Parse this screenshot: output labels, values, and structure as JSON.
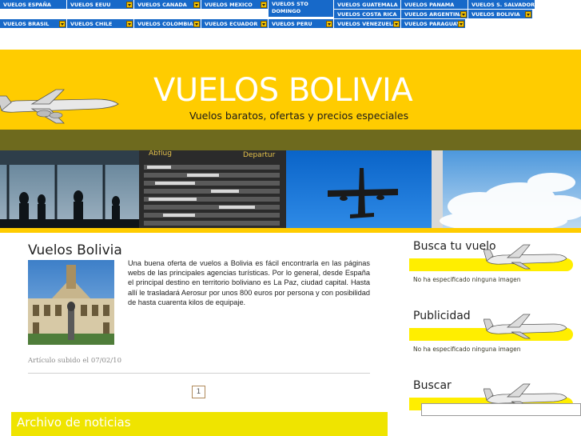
{
  "nav": {
    "items": [
      {
        "label": "VUELOS ESPAÑA"
      },
      {
        "label": "VUELOS EEUU"
      },
      {
        "label": "VUELOS CANADA"
      },
      {
        "label": "VUELOS MEXICO"
      },
      {
        "label": "VUELOS STO DOMINGO"
      },
      {
        "label": "VUELOS GUATEMALA"
      },
      {
        "label": "VUELOS PANAMA"
      },
      {
        "label": "VUELOS S. SALVADOR"
      },
      {
        "label": "VUELOS COSTA RICA"
      },
      {
        "label": "VUELOS ARGENTINA"
      },
      {
        "label": "VUELOS BOLIVIA"
      },
      {
        "label": "VUELOS BRASIL"
      },
      {
        "label": "VUELOS CHILE"
      },
      {
        "label": "VUELOS COLOMBIA"
      },
      {
        "label": "VUELOS ECUADOR"
      },
      {
        "label": "VUELOS PERU"
      },
      {
        "label": "VUELOS VENEZUELA"
      },
      {
        "label": "VUELOS PARAGUAY"
      }
    ]
  },
  "header": {
    "title": "VUELOS BOLIVIA",
    "subtitle": "Vuelos baratos, ofertas y precios especiales"
  },
  "article": {
    "title": "Vuelos Bolivia",
    "body": "Una buena oferta de vuelos a Bolivia es fácil encontrarla en las páginas webs de las principales agencias turísticas. Por lo general, desde España el principal destino en territorio boliviano es La Paz, ciudad capital. Hasta allí le trasladará Aerosur por unos 800 euros por persona y con posibilidad de hasta cuarenta kilos de equipaje.",
    "date": "Artículo subido el 07/02/10"
  },
  "pagination": {
    "page": "1"
  },
  "archive": {
    "title": "Archivo de noticias"
  },
  "sidebar": {
    "flight_search": {
      "title": "Busca tu vuelo",
      "note": "No ha especificado ninguna imagen"
    },
    "ads": {
      "title": "Publicidad",
      "note": "No ha especificado ninguna imagen"
    },
    "search": {
      "title": "Buscar"
    }
  },
  "colors": {
    "nav_blue": "#1769c9",
    "header_yellow": "#ffcc00",
    "header_bar_olive": "#6e6a1e",
    "archive_yellow": "#efe400",
    "widget_band_yellow": "#ffee00"
  }
}
